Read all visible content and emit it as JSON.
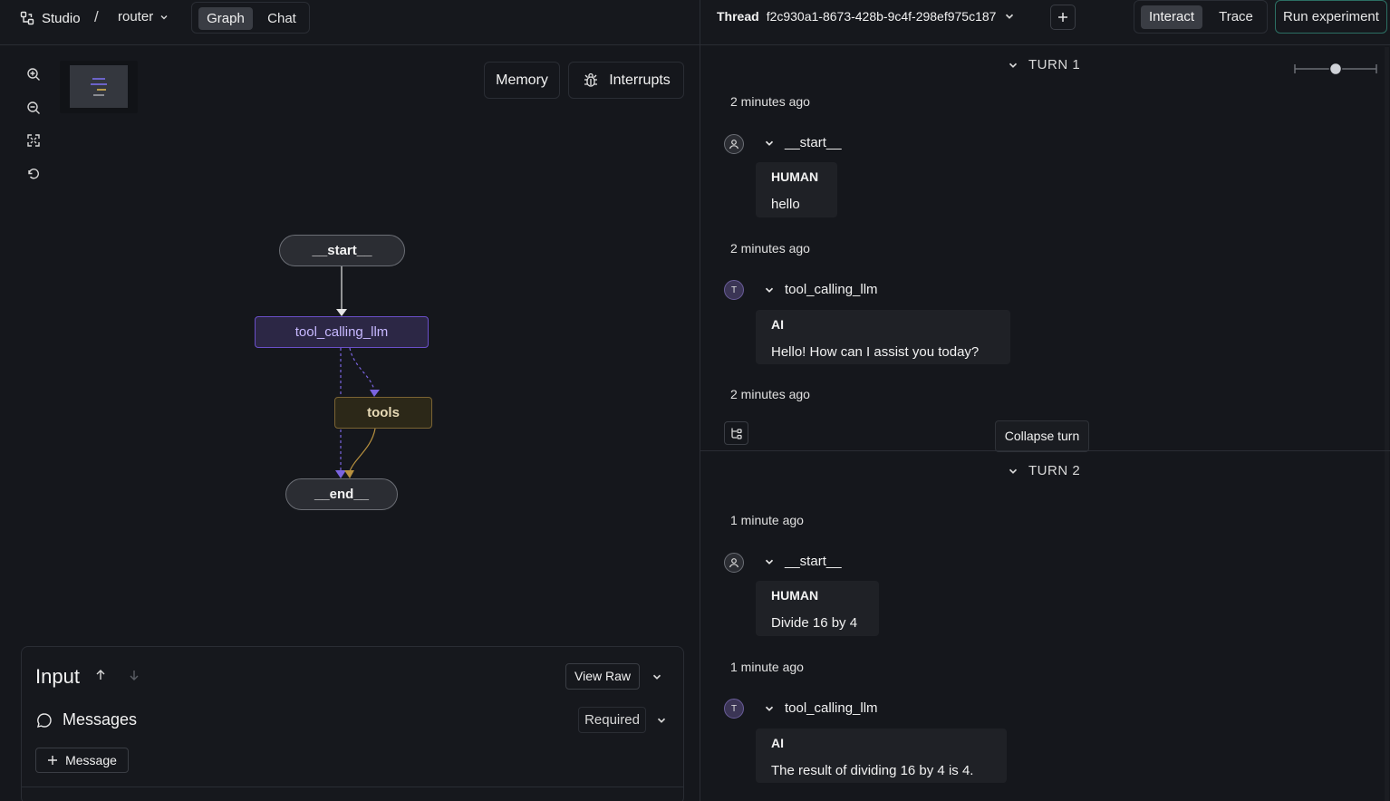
{
  "topbar": {
    "app_name": "Studio",
    "separator": "/",
    "graph_name": "router",
    "view_tabs": [
      {
        "label": "Graph",
        "active": true
      },
      {
        "label": "Chat",
        "active": false
      }
    ],
    "thread_label": "Thread",
    "thread_id": "f2c930a1-8673-428b-9c4f-298ef975c187",
    "mode_tabs": [
      {
        "label": "Interact",
        "active": true
      },
      {
        "label": "Trace",
        "active": false
      }
    ],
    "run_experiment_label": "Run experiment"
  },
  "graph_panel": {
    "toolbar_icons": [
      "zoom-in-icon",
      "zoom-out-icon",
      "fit-view-icon",
      "reset-icon"
    ],
    "memory_label": "Memory",
    "interrupts_label": "Interrupts",
    "nodes": {
      "start": "__start__",
      "llm": "tool_calling_llm",
      "tools": "tools",
      "end": "__end__"
    }
  },
  "input_panel": {
    "title": "Input",
    "view_raw_label": "View Raw",
    "messages_label": "Messages",
    "required_label": "Required",
    "add_message_label": "Message"
  },
  "thread": {
    "collapse_tooltip": "Collapse turn",
    "turns": [
      {
        "label": "TURN 1",
        "steps": [
          {
            "time": "2 minutes ago",
            "node": "__start__",
            "avatar": "user",
            "role": "HUMAN",
            "text": "hello"
          },
          {
            "time": "2 minutes ago",
            "node": "tool_calling_llm",
            "avatar": "T",
            "role": "AI",
            "text": "Hello! How can I assist you today?"
          }
        ],
        "end_time": "2 minutes ago"
      },
      {
        "label": "TURN 2",
        "steps": [
          {
            "time": "1 minute ago",
            "node": "__start__",
            "avatar": "user",
            "role": "HUMAN",
            "text": "Divide 16 by 4"
          },
          {
            "time": "1 minute ago",
            "node": "tool_calling_llm",
            "avatar": "T",
            "role": "AI",
            "text": "The result of dividing 16 by 4 is 4."
          }
        ]
      }
    ]
  },
  "colors": {
    "background": "#15171c",
    "llm_node": "#6a4fc8",
    "tools_node": "#7b6433",
    "run_button_border": "#2c6f63"
  }
}
